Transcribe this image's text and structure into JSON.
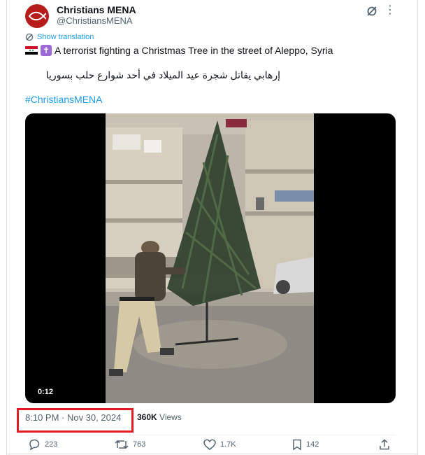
{
  "author": {
    "name": "Christians MENA",
    "handle": "@ChristiansMENA"
  },
  "tweet": {
    "show_translation": "Show translation",
    "text_en": "A terrorist fighting a Christmas Tree in the street of Aleppo, Syria",
    "text_ar": "إرهابي يقاتل شجرة عيد الميلاد في أحد شوارع حلب بسوريا",
    "hashtag": "#ChristiansMENA"
  },
  "video": {
    "duration": "0:12"
  },
  "meta": {
    "timestamp": "8:10 PM · Nov 30, 2024",
    "views_count": "360K",
    "views_label": "Views"
  },
  "actions": {
    "replies": "223",
    "reposts": "763",
    "likes": "1.7K",
    "bookmarks": "142"
  },
  "colors": {
    "accent": "#1d9bf0",
    "highlight_box": "#e31b23",
    "avatar": "#b71c1c"
  },
  "icons": [
    "avatar-fish-icon",
    "grok-icon",
    "more-icon",
    "translate-icon",
    "syria-flag-icon",
    "cross-icon",
    "reply-icon",
    "repost-icon",
    "like-icon",
    "bookmark-icon",
    "share-icon"
  ]
}
